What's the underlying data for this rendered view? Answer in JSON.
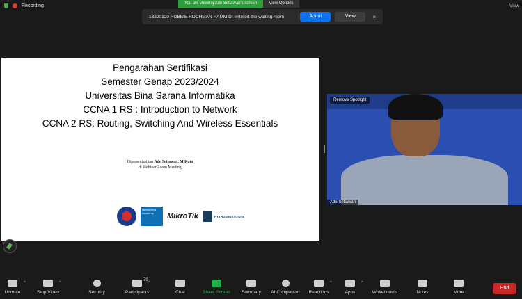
{
  "recording": {
    "label": "Recording"
  },
  "top": {
    "viewing_banner": "You are viewing Ade Setiawan's screen",
    "view_options": "View Options",
    "view": "View"
  },
  "notification": {
    "message": "13220120 ROBBIE ROCHMAN HAMMIDI entered the waiting room",
    "admit": "Admit",
    "view": "View",
    "close": "×"
  },
  "slide": {
    "lines": [
      "Pengarahan Sertifikasi",
      "Semester Genap 2023/2024",
      "Universitas Bina Sarana Informatika",
      "CCNA 1 RS : Introduction to Network",
      "CCNA 2 RS: Routing, Switching And Wireless Essentials"
    ],
    "presented_by_prefix": "Dipresentasikan",
    "presenter_name": "Ade Setiawan, M.Kom",
    "presenter_line2": "di Webinar Zoom Meeting",
    "logo_cisco_text": "Networking Academy",
    "logo_mikrotik": "MikroTik",
    "logo_python": "PYTHON INSTITUTE"
  },
  "video": {
    "remove_spotlight": "Remove Spotlight",
    "name": "Ade Setiawan"
  },
  "toolbar": {
    "participants_count": "79",
    "items": [
      {
        "label": "Unmute",
        "icon": "microphone-muted-icon"
      },
      {
        "label": "Stop Video",
        "icon": "video-camera-icon"
      },
      {
        "label": "Security",
        "icon": "shield-icon"
      },
      {
        "label": "Participants",
        "icon": "participants-icon"
      },
      {
        "label": "Chat",
        "icon": "chat-icon"
      },
      {
        "label": "Share Screen",
        "icon": "share-screen-icon"
      },
      {
        "label": "Summary",
        "icon": "summary-icon"
      },
      {
        "label": "AI Companion",
        "icon": "sparkle-icon"
      },
      {
        "label": "Reactions",
        "icon": "reactions-icon"
      },
      {
        "label": "Apps",
        "icon": "apps-icon"
      },
      {
        "label": "Whiteboards",
        "icon": "whiteboard-icon"
      },
      {
        "label": "Notes",
        "icon": "notes-icon"
      },
      {
        "label": "More",
        "icon": "more-icon"
      }
    ],
    "end": "End"
  },
  "colors": {
    "admit": "#0e72ed",
    "share": "#22b24c",
    "end": "#c62828",
    "banner": "#2e9d3a"
  }
}
